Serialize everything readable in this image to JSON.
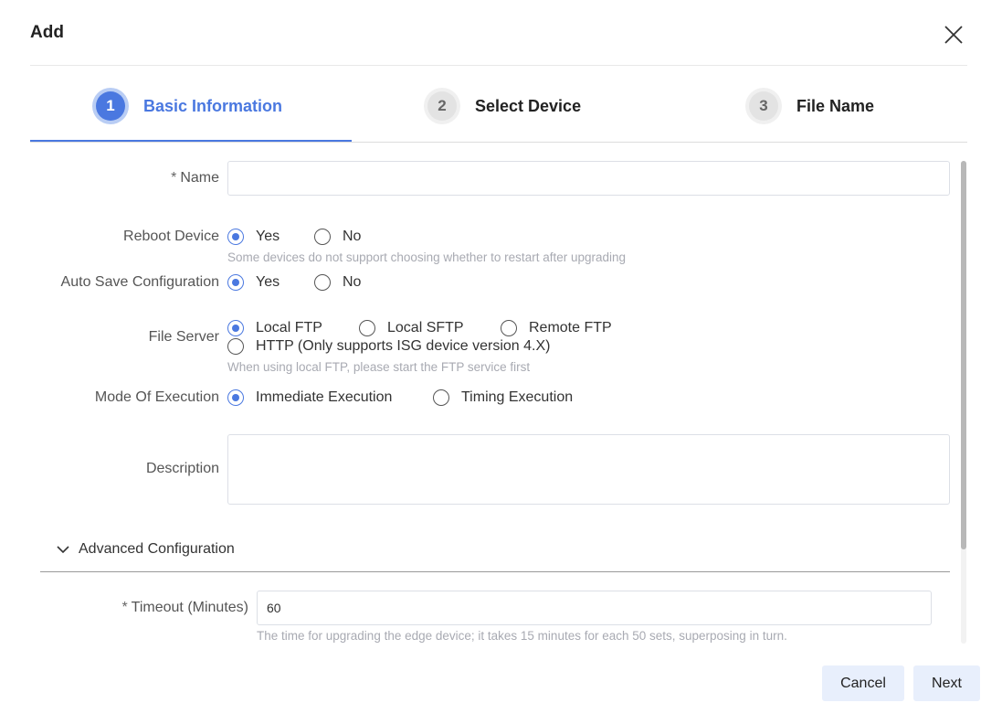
{
  "dialog": {
    "title": "Add",
    "close_icon": "close-icon"
  },
  "steps": [
    {
      "number": "1",
      "label": "Basic Information",
      "state": "active"
    },
    {
      "number": "2",
      "label": "Select Device",
      "state": "inactive"
    },
    {
      "number": "3",
      "label": "File Name",
      "state": "inactive"
    }
  ],
  "form": {
    "required_mark": "*",
    "name": {
      "label": "Name",
      "value": "",
      "placeholder": ""
    },
    "reboot_device": {
      "label": "Reboot Device",
      "options": [
        "Yes",
        "No"
      ],
      "selected": "Yes",
      "hint": "Some devices do not support choosing whether to restart after upgrading"
    },
    "auto_save": {
      "label": "Auto Save Configuration",
      "options": [
        "Yes",
        "No"
      ],
      "selected": "Yes"
    },
    "file_server": {
      "label": "File Server",
      "options": [
        "Local FTP",
        "Local SFTP",
        "Remote FTP",
        "HTTP (Only supports ISG device version 4.X)"
      ],
      "selected": "Local FTP",
      "hint": "When using local FTP, please start the FTP service first"
    },
    "mode_of_execution": {
      "label": "Mode Of Execution",
      "options": [
        "Immediate Execution",
        "Timing Execution"
      ],
      "selected": "Immediate Execution"
    },
    "description": {
      "label": "Description",
      "value": ""
    }
  },
  "advanced": {
    "toggle_label": "Advanced Configuration",
    "expanded": true,
    "timeout": {
      "label": "Timeout (Minutes)",
      "value": "60",
      "hint": "The time for upgrading the edge device; it takes 15 minutes for each 50 sets, superposing in turn."
    }
  },
  "footer": {
    "cancel_label": "Cancel",
    "next_label": "Next"
  },
  "colors": {
    "accent": "#4a78e0",
    "button_bg": "#e8effc",
    "hint": "#a8aab2"
  }
}
